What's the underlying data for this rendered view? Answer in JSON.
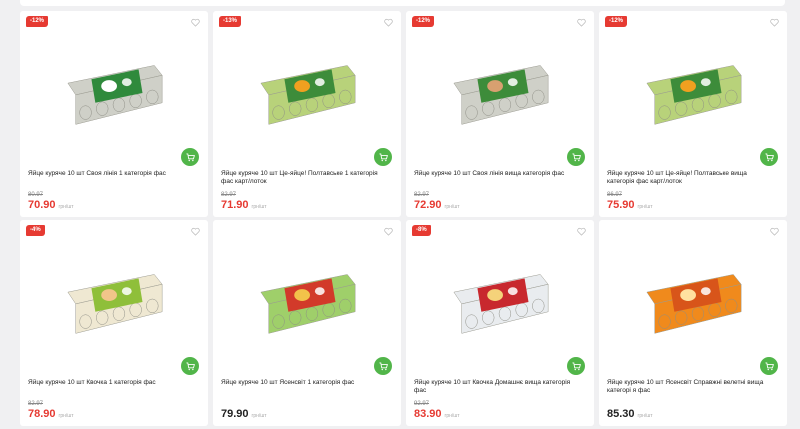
{
  "currency": "грн/шт",
  "colors": {
    "sale": "#e63a32",
    "cart": "#51b549",
    "carton_green": "#9fcf6a",
    "carton_orange": "#f08a1c"
  },
  "icons": {
    "wishlist": "heart-icon",
    "cart": "cart-icon"
  },
  "products": [
    {
      "badge": "-12%",
      "name": "Яйце куряче 10 шт Своя лінія 1 категорія фас",
      "old_price": "80.97",
      "price": "70.90",
      "image": "egg-carton-grey-green",
      "sale": true
    },
    {
      "badge": "-13%",
      "name": "Яйце куряче 10 шт Це-яйце! Полтавське 1 категорія фас карт/лоток",
      "old_price": "82.97",
      "price": "71.90",
      "image": "egg-carton-green-label",
      "sale": true
    },
    {
      "badge": "-12%",
      "name": "Яйце куряче 10 шт Своя лінія вища категорія фас",
      "old_price": "82.97",
      "price": "72.90",
      "image": "egg-carton-grey-brown",
      "sale": true
    },
    {
      "badge": "-12%",
      "name": "Яйце куряче 10 шт Це-яйце! Полтавське вища категорія фас карт/лоток",
      "old_price": "86.97",
      "price": "75.90",
      "image": "egg-carton-green-label",
      "sale": true
    },
    {
      "badge": "-4%",
      "name": "Яйце куряче 10 шт Квочка 1 категорія фас",
      "old_price": "82.97",
      "price": "78.90",
      "image": "egg-carton-clear",
      "sale": true
    },
    {
      "badge": "",
      "name": "Яйце куряче 10 шт Ясенсвіт 1 категорія фас",
      "old_price": "",
      "price": "79.90",
      "image": "egg-carton-green-red",
      "sale": false
    },
    {
      "badge": "-8%",
      "name": "Яйце куряче 10 шт Квочка Домашнє вища категорія фас",
      "old_price": "92.97",
      "price": "83.90",
      "image": "egg-carton-white-red",
      "sale": true
    },
    {
      "badge": "",
      "name": "Яйце куряче 10 шт Ясенсвіт Справжні велетні вища категорі я фас",
      "old_price": "",
      "price": "85.30",
      "image": "egg-carton-orange",
      "sale": false
    }
  ]
}
